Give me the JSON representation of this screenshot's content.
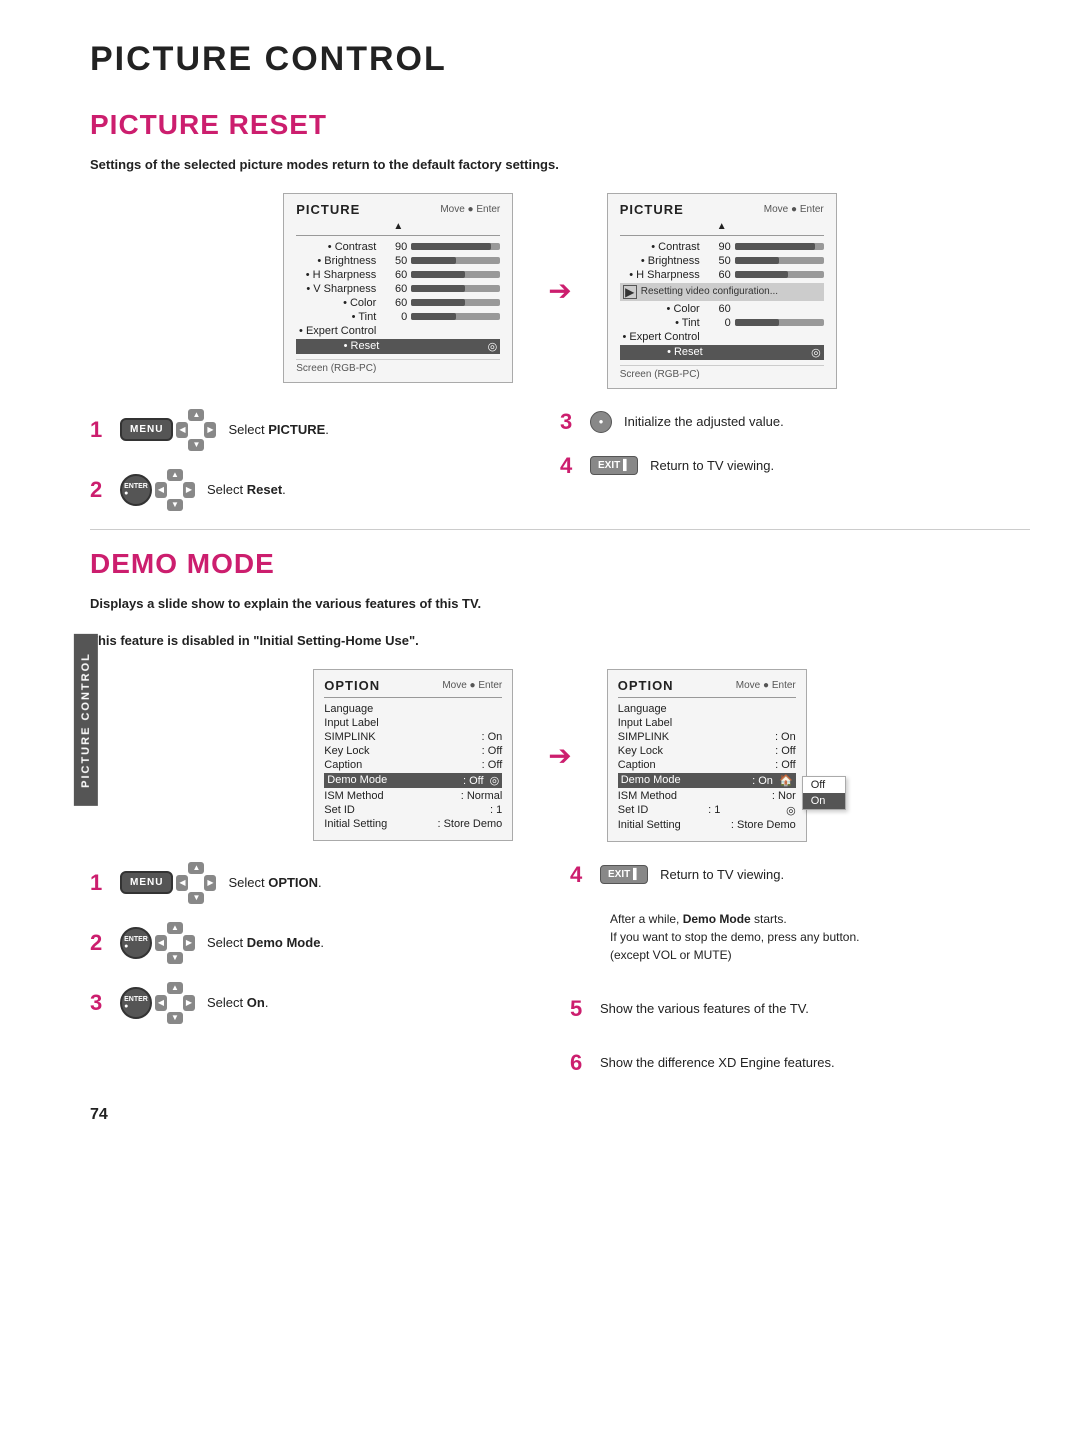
{
  "page": {
    "side_tab": "PICTURE CONTROL",
    "title": "PICTURE CONTROL",
    "section1": {
      "title": "PICTURE RESET",
      "description": "Settings of the selected picture modes return to the default factory settings.",
      "screen_left": {
        "title": "PICTURE",
        "nav": "Move  ● Enter",
        "up_arrow": "▲",
        "rows": [
          {
            "label": "• Contrast",
            "value": "90",
            "bar_pct": 90
          },
          {
            "label": "• Brightness",
            "value": "50",
            "bar_pct": 50
          },
          {
            "label": "• H Sharpness",
            "value": "60",
            "bar_pct": 60
          },
          {
            "label": "• V Sharpness",
            "value": "60",
            "bar_pct": 60
          },
          {
            "label": "• Color",
            "value": "60",
            "bar_pct": 60
          },
          {
            "label": "• Tint",
            "value": "0",
            "bar_pct": 50
          },
          {
            "label": "• Expert Control",
            "value": "",
            "bar_pct": 0
          },
          {
            "label": "• Reset",
            "value": "",
            "bar_pct": 0,
            "enter_icon": true
          }
        ],
        "footer": "Screen (RGB-PC)"
      },
      "screen_right": {
        "title": "PICTURE",
        "nav": "Move  ● Enter",
        "up_arrow": "▲",
        "rows": [
          {
            "label": "• Contrast",
            "value": "90",
            "bar_pct": 90
          },
          {
            "label": "• Brightness",
            "value": "50",
            "bar_pct": 50
          },
          {
            "label": "• H Sharpness",
            "value": "60",
            "bar_pct": 60
          },
          {
            "label": "overlay",
            "value": "",
            "text": "Resetting video configuration..."
          },
          {
            "label": "• Color",
            "value": "60",
            "bar_pct": 0
          },
          {
            "label": "• Tint",
            "value": "0",
            "bar_pct": 50
          },
          {
            "label": "• Expert Control",
            "value": "",
            "bar_pct": 0
          },
          {
            "label": "• Reset",
            "value": "",
            "bar_pct": 0,
            "enter_icon": true
          }
        ],
        "footer": "Screen (RGB-PC)"
      },
      "steps_left": [
        {
          "num": "1",
          "btn_label": "MENU",
          "has_dpad": true,
          "text": "Select <b>PICTURE</b>."
        },
        {
          "num": "2",
          "btn_label": "ENTER",
          "has_dpad": true,
          "text": "Select <b>Reset</b>."
        }
      ],
      "steps_right": [
        {
          "num": "3",
          "type": "enter",
          "text": "Initialize the adjusted value."
        },
        {
          "num": "4",
          "type": "exit",
          "text": "Return to TV viewing."
        }
      ]
    },
    "section2": {
      "title": "DEMO MODE",
      "description1": "Displays a slide show to explain the various features of this TV.",
      "description2": "This feature is disabled in \"<b>Initial Setting-Home Use</b>\".",
      "option_left": {
        "title": "OPTION",
        "nav": "Move  ● Enter",
        "rows": [
          {
            "label": "Language",
            "value": ""
          },
          {
            "label": "Input Label",
            "value": ""
          },
          {
            "label": "SIMPLINK",
            "value": ": On"
          },
          {
            "label": "Key Lock",
            "value": ": Off"
          },
          {
            "label": "Caption",
            "value": ": Off"
          },
          {
            "label": "Demo Mode",
            "value": ": Off",
            "highlighted": true,
            "enter_icon": true
          },
          {
            "label": "ISM Method",
            "value": ": Normal"
          },
          {
            "label": "Set ID",
            "value": ": 1"
          },
          {
            "label": "Initial Setting",
            "value": ": Store Demo"
          }
        ]
      },
      "option_right": {
        "title": "OPTION",
        "nav": "Move  ● Enter",
        "rows": [
          {
            "label": "Language",
            "value": ""
          },
          {
            "label": "Input Label",
            "value": ""
          },
          {
            "label": "SIMPLINK",
            "value": ": On"
          },
          {
            "label": "Key Lock",
            "value": ": Off"
          },
          {
            "label": "Caption",
            "value": ": Off"
          },
          {
            "label": "Demo Mode",
            "value": ": On",
            "highlighted": true
          },
          {
            "label": "ISM Method",
            "value": ": Nor"
          },
          {
            "label": "Set ID",
            "value": ": 1",
            "enter_icon": true
          },
          {
            "label": "Initial Setting",
            "value": ": Store Demo"
          }
        ],
        "popup": {
          "items": [
            {
              "label": "Off",
              "selected": false
            },
            {
              "label": "On",
              "selected": true
            }
          ]
        }
      },
      "steps_left": [
        {
          "num": "1",
          "btn_label": "MENU",
          "has_dpad": true,
          "text": "Select <b>OPTION</b>."
        },
        {
          "num": "2",
          "btn_label": "ENTER",
          "has_dpad": true,
          "text": "Select <b>Demo Mode</b>."
        },
        {
          "num": "3",
          "btn_label": "ENTER",
          "has_dpad": true,
          "text": "Select <b>On</b>."
        }
      ],
      "steps_right": [
        {
          "num": "4",
          "type": "exit",
          "text": "Return to TV viewing."
        },
        {
          "desc": "After a while, <b>Demo Mode</b> starts.\nIf you want to stop the demo, press any button.\n(except VOL or MUTE)"
        },
        {
          "num": "5",
          "text": "Show the various features of the TV."
        },
        {
          "num": "6",
          "text": "Show the difference XD Engine features."
        }
      ]
    },
    "page_number": "74"
  }
}
